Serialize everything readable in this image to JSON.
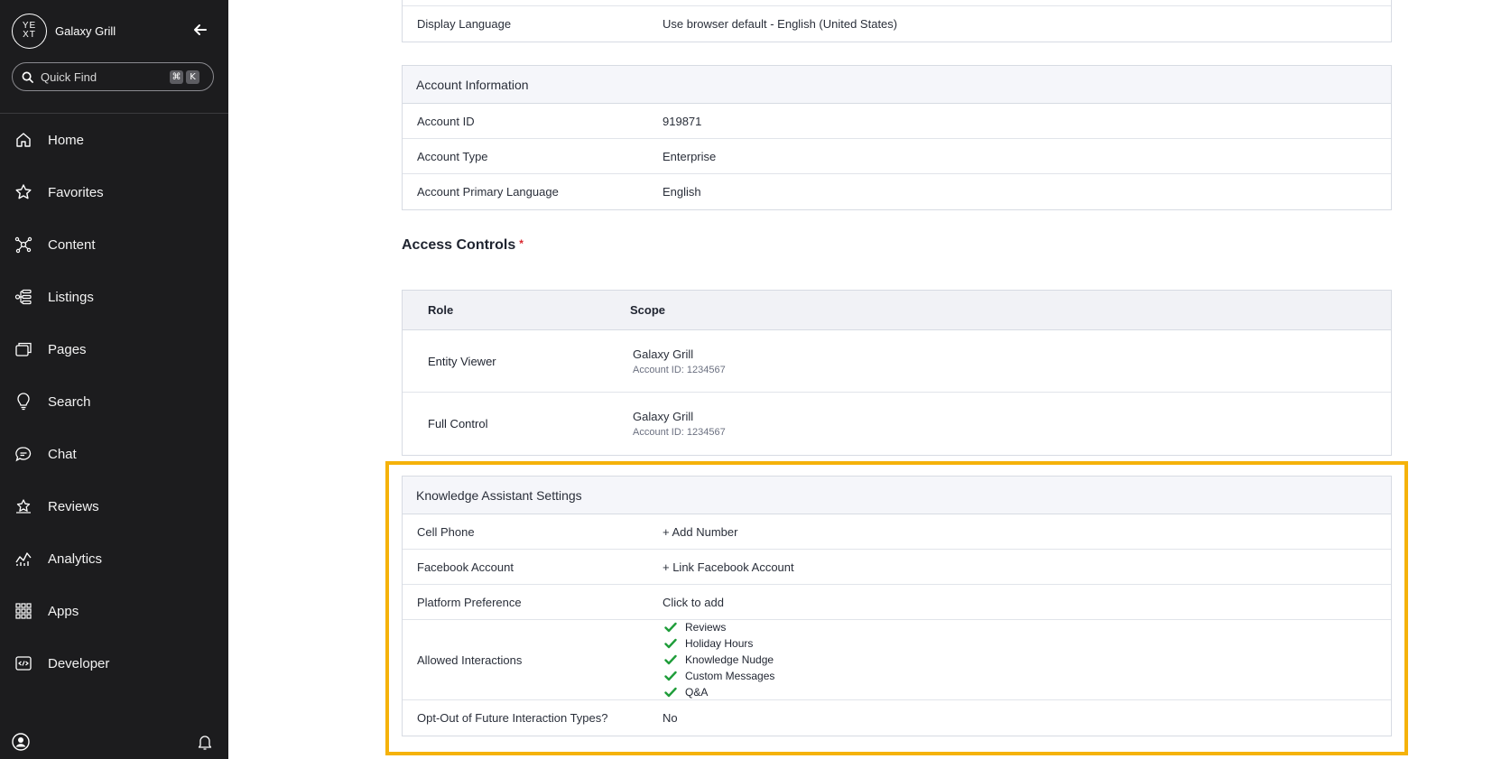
{
  "sidebar": {
    "logo_text": "YEXT",
    "brand_name": "Galaxy Grill",
    "quickfind_placeholder": "Quick Find",
    "shortcut_keys": [
      "⌘",
      "K"
    ],
    "items": [
      {
        "label": "Home",
        "icon": "home-icon"
      },
      {
        "label": "Favorites",
        "icon": "star-icon"
      },
      {
        "label": "Content",
        "icon": "content-icon"
      },
      {
        "label": "Listings",
        "icon": "listings-icon"
      },
      {
        "label": "Pages",
        "icon": "pages-icon"
      },
      {
        "label": "Search",
        "icon": "lightbulb-icon"
      },
      {
        "label": "Chat",
        "icon": "chat-icon"
      },
      {
        "label": "Reviews",
        "icon": "reviews-icon"
      },
      {
        "label": "Analytics",
        "icon": "analytics-icon"
      },
      {
        "label": "Apps",
        "icon": "apps-grid-icon"
      },
      {
        "label": "Developer",
        "icon": "developer-icon"
      }
    ]
  },
  "preferences": {
    "display_language_label": "Display Language",
    "display_language_value": "Use browser default - English (United States)"
  },
  "account_information": {
    "title": "Account Information",
    "rows": [
      {
        "label": "Account ID",
        "value": "919871"
      },
      {
        "label": "Account Type",
        "value": "Enterprise"
      },
      {
        "label": "Account Primary Language",
        "value": "English"
      }
    ]
  },
  "access_controls": {
    "title": "Access Controls",
    "required_mark": "*",
    "columns": [
      "Role",
      "Scope"
    ],
    "rows": [
      {
        "role": "Entity Viewer",
        "scope_name": "Galaxy Grill",
        "scope_sub": "Account ID: 1234567"
      },
      {
        "role": "Full Control",
        "scope_name": "Galaxy Grill",
        "scope_sub": "Account ID: 1234567"
      }
    ]
  },
  "knowledge_assistant": {
    "title": "Knowledge Assistant Settings",
    "cell_phone_label": "Cell Phone",
    "cell_phone_action": "+ Add Number",
    "facebook_label": "Facebook Account",
    "facebook_action": "+ Link Facebook Account",
    "platform_label": "Platform Preference",
    "platform_value": "Click to add",
    "allowed_label": "Allowed Interactions",
    "allowed_items": [
      "Reviews",
      "Holiday Hours",
      "Knowledge Nudge",
      "Custom Messages",
      "Q&A"
    ],
    "optout_label": "Opt-Out of Future Interaction Types?",
    "optout_value": "No"
  },
  "colors": {
    "sidebar_bg": "#1c1c1e",
    "highlight": "#f5b20a",
    "link": "#5a55d6",
    "check": "#1f9d3a",
    "required": "#d9262e"
  }
}
